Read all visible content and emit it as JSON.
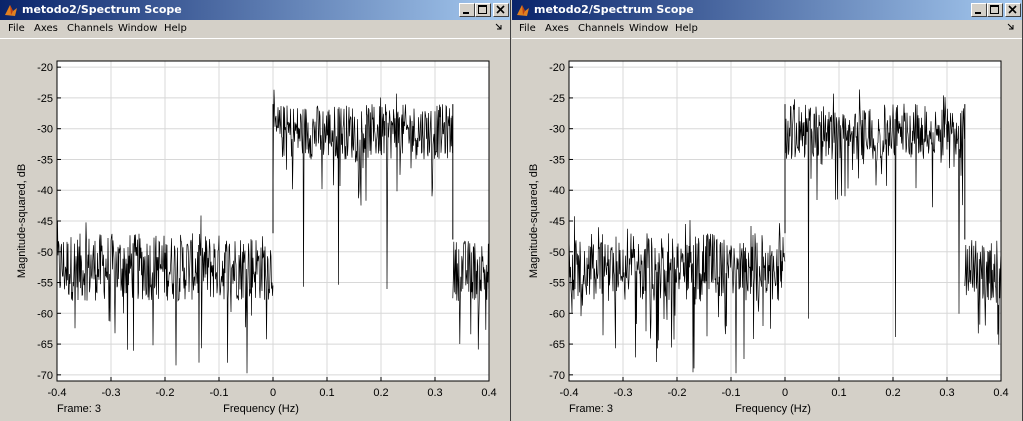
{
  "windows": [
    {
      "title": "metodo2/Spectrum Scope",
      "menu": [
        "File",
        "Axes",
        "Channels",
        "Window",
        "Help"
      ],
      "controls": [
        "minimize-icon",
        "maximize-icon",
        "close-icon"
      ],
      "frame_label": "Frame: 3",
      "chart_data": {
        "type": "line",
        "xlabel": "Frequency (Hz)",
        "ylabel": "Magnitude-squared, dB",
        "xlim": [
          -0.4,
          0.4
        ],
        "ylim": [
          -71,
          -19
        ],
        "xticks": [
          "-0.4",
          "-0.3",
          "-0.2",
          "-0.1",
          "0",
          "0.1",
          "0.2",
          "0.3",
          "0.4"
        ],
        "yticks": [
          "-20",
          "-25",
          "-30",
          "-35",
          "-40",
          "-45",
          "-50",
          "-55",
          "-60",
          "-65",
          "-70"
        ],
        "grid": true,
        "series": [
          {
            "segments": [
              {
                "x_start": -0.4,
                "x_end": 0.0,
                "band_mean": -53,
                "band_low": -58,
                "band_high": -47,
                "spike_min": -70
              },
              {
                "x_start": 0.0,
                "x_end": 0.333,
                "band_mean": -30,
                "band_low": -35,
                "band_high": -26,
                "spike_min": -57
              },
              {
                "x_start": 0.333,
                "x_end": 0.4,
                "band_mean": -53,
                "band_low": -58,
                "band_high": -48,
                "spike_min": -67
              }
            ]
          }
        ]
      }
    },
    {
      "title": "metodo2/Spectrum Scope",
      "menu": [
        "File",
        "Axes",
        "Channels",
        "Window",
        "Help"
      ],
      "controls": [
        "minimize-icon",
        "maximize-icon",
        "close-icon"
      ],
      "frame_label": "Frame: 3",
      "chart_data": {
        "type": "line",
        "xlabel": "Frequency (Hz)",
        "ylabel": "Magnitude-squared, dB",
        "xlim": [
          -0.4,
          0.4
        ],
        "ylim": [
          -71,
          -19
        ],
        "xticks": [
          "-0.4",
          "-0.3",
          "-0.2",
          "-0.1",
          "0",
          "0.1",
          "0.2",
          "0.3",
          "0.4"
        ],
        "yticks": [
          "-20",
          "-25",
          "-30",
          "-35",
          "-40",
          "-45",
          "-50",
          "-55",
          "-60",
          "-65",
          "-70"
        ],
        "grid": true,
        "series": [
          {
            "segments": [
              {
                "x_start": -0.4,
                "x_end": 0.0,
                "band_mean": -53,
                "band_low": -58,
                "band_high": -47,
                "spike_min": -71
              },
              {
                "x_start": 0.0,
                "x_end": 0.333,
                "band_mean": -30,
                "band_low": -35,
                "band_high": -26,
                "spike_min": -64
              },
              {
                "x_start": 0.333,
                "x_end": 0.4,
                "band_mean": -53,
                "band_low": -58,
                "band_high": -48,
                "spike_min": -69
              }
            ]
          }
        ]
      }
    }
  ],
  "colors": {
    "title_gradient_start": "#0a246a",
    "title_gradient_end": "#a6caf0",
    "trace": "#000000",
    "grid": "#d8d8d8",
    "window_bg": "#d4d0c8"
  }
}
